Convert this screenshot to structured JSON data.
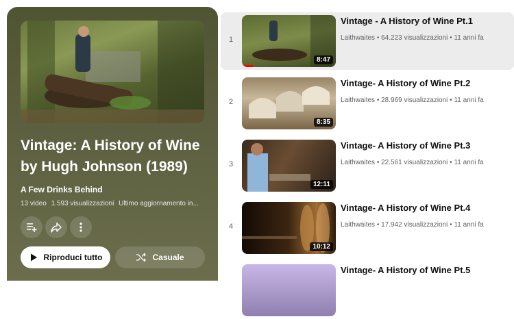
{
  "playlist": {
    "title": "Vintage: A History of Wine by Hugh Johnson (1989)",
    "channel": "A Few Drinks Behind",
    "video_count": "13 video",
    "views": "1.593 visualizzazioni",
    "updated": "Ultimo aggiornamento in...",
    "play_all_label": "Riproduci tutto",
    "shuffle_label": "Casuale"
  },
  "videos": [
    {
      "index": "1",
      "title": "Vintage - A History of Wine Pt.1",
      "channel": "Laithwaites",
      "views": "64.223 visualizzazioni",
      "age": "11 anni fa",
      "duration": "8:47",
      "watched_fraction": 0.12
    },
    {
      "index": "2",
      "title": "Vintage- A History of Wine Pt.2",
      "channel": "Laithwaites",
      "views": "28.969 visualizzazioni",
      "age": "11 anni fa",
      "duration": "8:35"
    },
    {
      "index": "3",
      "title": "Vintage- A History of Wine Pt.3",
      "channel": "Laithwaites",
      "views": "22.561 visualizzazioni",
      "age": "11 anni fa",
      "duration": "12:11"
    },
    {
      "index": "4",
      "title": "Vintage- A History of Wine Pt.4",
      "channel": "Laithwaites",
      "views": "17.942 visualizzazioni",
      "age": "11 anni fa",
      "duration": "10:12"
    },
    {
      "index": "",
      "title": "Vintage- A History of Wine Pt.5",
      "channel": "",
      "views": "",
      "age": "",
      "duration": ""
    }
  ],
  "meta_separator": "•",
  "icons": [
    "save-to-playlist-icon",
    "share-icon",
    "more-options-icon",
    "play-icon",
    "shuffle-icon"
  ],
  "colors": {
    "panel": "#5d6040",
    "progress": "#ff0000",
    "active_row": "#ececec"
  }
}
